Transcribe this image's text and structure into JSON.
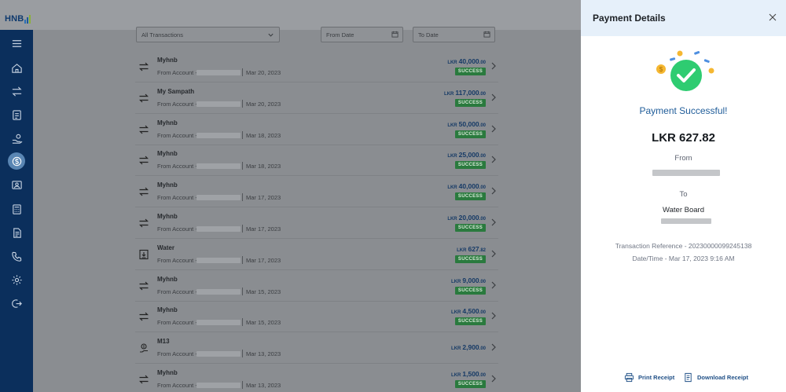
{
  "brand": {
    "logo_text": "HNB"
  },
  "filters": {
    "transaction_type": "All Transactions",
    "from_date": "From Date",
    "to_date": "To Date"
  },
  "transactions": [
    {
      "name": "Myhnb",
      "from_label": "From Account -",
      "date": "Mar 20, 2023",
      "currency": "LKR",
      "amount": "40,000",
      "decimals": ".00",
      "status": "SUCCESS",
      "icon": "transfer-icon"
    },
    {
      "name": "My Sampath",
      "from_label": "From Account -",
      "date": "Mar 20, 2023",
      "currency": "LKR",
      "amount": "117,000",
      "decimals": ".00",
      "status": "SUCCESS",
      "icon": "transfer-icon"
    },
    {
      "name": "Myhnb",
      "from_label": "From Account -",
      "date": "Mar 18, 2023",
      "currency": "LKR",
      "amount": "50,000",
      "decimals": ".00",
      "status": "SUCCESS",
      "icon": "transfer-icon"
    },
    {
      "name": "Myhnb",
      "from_label": "From Account -",
      "date": "Mar 18, 2023",
      "currency": "LKR",
      "amount": "25,000",
      "decimals": ".00",
      "status": "SUCCESS",
      "icon": "transfer-icon"
    },
    {
      "name": "Myhnb",
      "from_label": "From Account -",
      "date": "Mar 17, 2023",
      "currency": "LKR",
      "amount": "40,000",
      "decimals": ".00",
      "status": "SUCCESS",
      "icon": "transfer-icon"
    },
    {
      "name": "Myhnb",
      "from_label": "From Account -",
      "date": "Mar 17, 2023",
      "currency": "LKR",
      "amount": "20,000",
      "decimals": ".00",
      "status": "SUCCESS",
      "icon": "transfer-icon"
    },
    {
      "name": "Water",
      "from_label": "From Account -",
      "date": "Mar 17, 2023",
      "currency": "LKR",
      "amount": "627",
      "decimals": ".82",
      "status": "SUCCESS",
      "icon": "bill-icon"
    },
    {
      "name": "Myhnb",
      "from_label": "From Account -",
      "date": "Mar 15, 2023",
      "currency": "LKR",
      "amount": "9,000",
      "decimals": ".00",
      "status": "SUCCESS",
      "icon": "transfer-icon"
    },
    {
      "name": "Myhnb",
      "from_label": "From Account -",
      "date": "Mar 15, 2023",
      "currency": "LKR",
      "amount": "4,500",
      "decimals": ".00",
      "status": "SUCCESS",
      "icon": "transfer-icon"
    },
    {
      "name": "M13",
      "from_label": "From Account -",
      "date": "Mar 13, 2023",
      "currency": "LKR",
      "amount": "2,900",
      "decimals": ".00",
      "status": "",
      "icon": "payee-icon"
    },
    {
      "name": "Myhnb",
      "from_label": "From Account -",
      "date": "Mar 13, 2023",
      "currency": "LKR",
      "amount": "1,500",
      "decimals": ".00",
      "status": "SUCCESS",
      "icon": "transfer-icon"
    }
  ],
  "panel": {
    "title": "Payment Details",
    "success_message": "Payment Successful!",
    "amount": "LKR 627.82",
    "from_label": "From",
    "to_label": "To",
    "to_name": "Water Board",
    "reference": "Transaction Reference - 20230000099245138",
    "datetime": "Date/Time - Mar 17, 2023 9:16 AM",
    "print_label": "Print Receipt",
    "download_label": "Download Receipt"
  },
  "colors": {
    "sidebar": "#0b2f5c",
    "success_badge": "#2a7a3e",
    "accent": "#1f5c99",
    "success_check": "#2ecc71"
  }
}
